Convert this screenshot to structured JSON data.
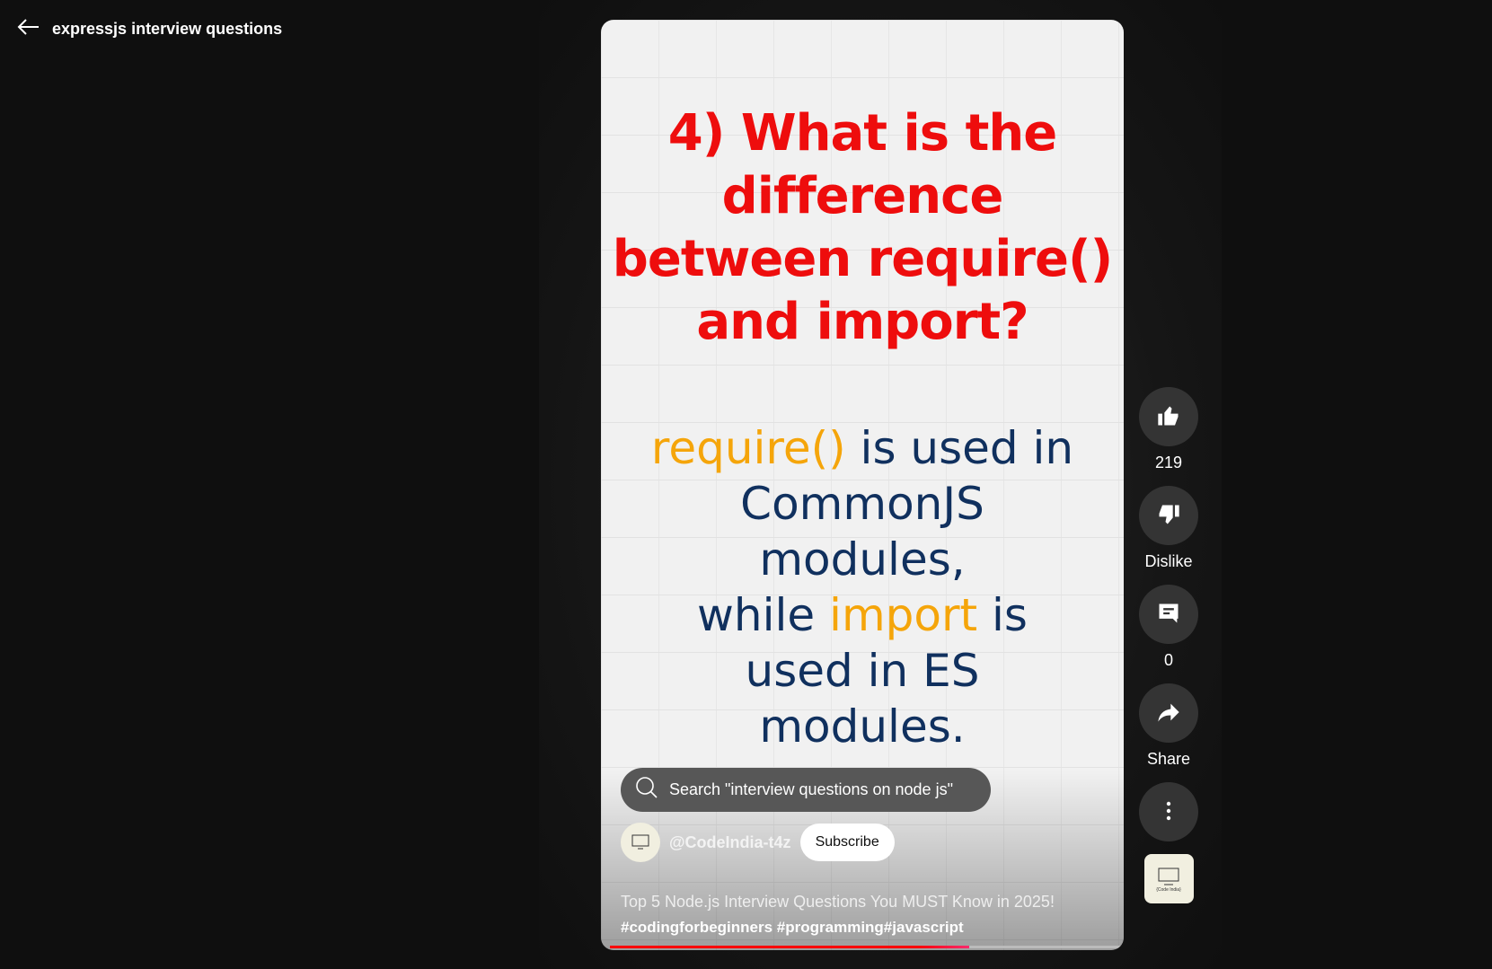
{
  "header": {
    "title": "expressjs interview questions",
    "back_icon": "arrow-left-icon"
  },
  "video": {
    "question": [
      "4) What is the",
      "difference",
      "between require()",
      "and import?"
    ],
    "answer": {
      "l1a": "require()",
      "l1b": " is used in",
      "l2": "CommonJS",
      "l3": "modules,",
      "l4a": "while ",
      "l4b": "import",
      "l4c": " is",
      "l5": "used in ES",
      "l6": "modules."
    },
    "progress_percent": 70
  },
  "search_chip": {
    "label": "Search \"interview questions on node js\""
  },
  "channel": {
    "handle": "@CodeIndia-t4z",
    "subscribe_label": "Subscribe",
    "avatar_text": "{Code India}"
  },
  "description": {
    "title": "Top 5 Node.js Interview Questions You MUST Know in 2025!",
    "tags": "#codingforbeginners #programming#javascript"
  },
  "actions": {
    "likes": "219",
    "dislike": "Dislike",
    "comments": "0",
    "share": "Share"
  },
  "colors": {
    "question": "#ee0d0d",
    "answer": "#10305e",
    "highlight": "#f5a50a",
    "progress": "#ff0000"
  }
}
